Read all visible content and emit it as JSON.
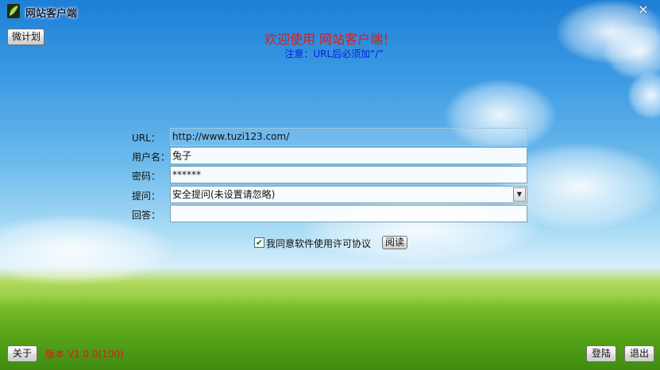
{
  "window": {
    "title": "网站客户端",
    "close_glyph": "×"
  },
  "toolbar": {
    "micro_plan_label": "微计划"
  },
  "header": {
    "welcome": "欢迎使用 网站客户端！",
    "notice": "注意：URL后必须加“/”"
  },
  "form": {
    "url_label": "URL：",
    "url_value": "http://www.tuzi123.com/",
    "username_label": "用户名：",
    "username_value": "兔子",
    "password_label": "密码：",
    "password_value": "******",
    "question_label": "提问：",
    "question_value": "安全提问(未设置请忽略)",
    "answer_label": "回答：",
    "answer_value": ""
  },
  "agreement": {
    "checked": true,
    "text": "我同意软件使用许可协议",
    "read_label": "阅读"
  },
  "footer": {
    "about_label": "关于",
    "version_text": "版本 V1.0.0(100)",
    "login_label": "登陆",
    "exit_label": "退出"
  },
  "icons": {
    "app": "leaf-icon",
    "close": "close-icon",
    "dropdown": "chevron-down-icon",
    "check": "check-icon"
  },
  "colors": {
    "welcome": "#e01818",
    "notice": "#0a1ee0",
    "version": "#e01818"
  }
}
